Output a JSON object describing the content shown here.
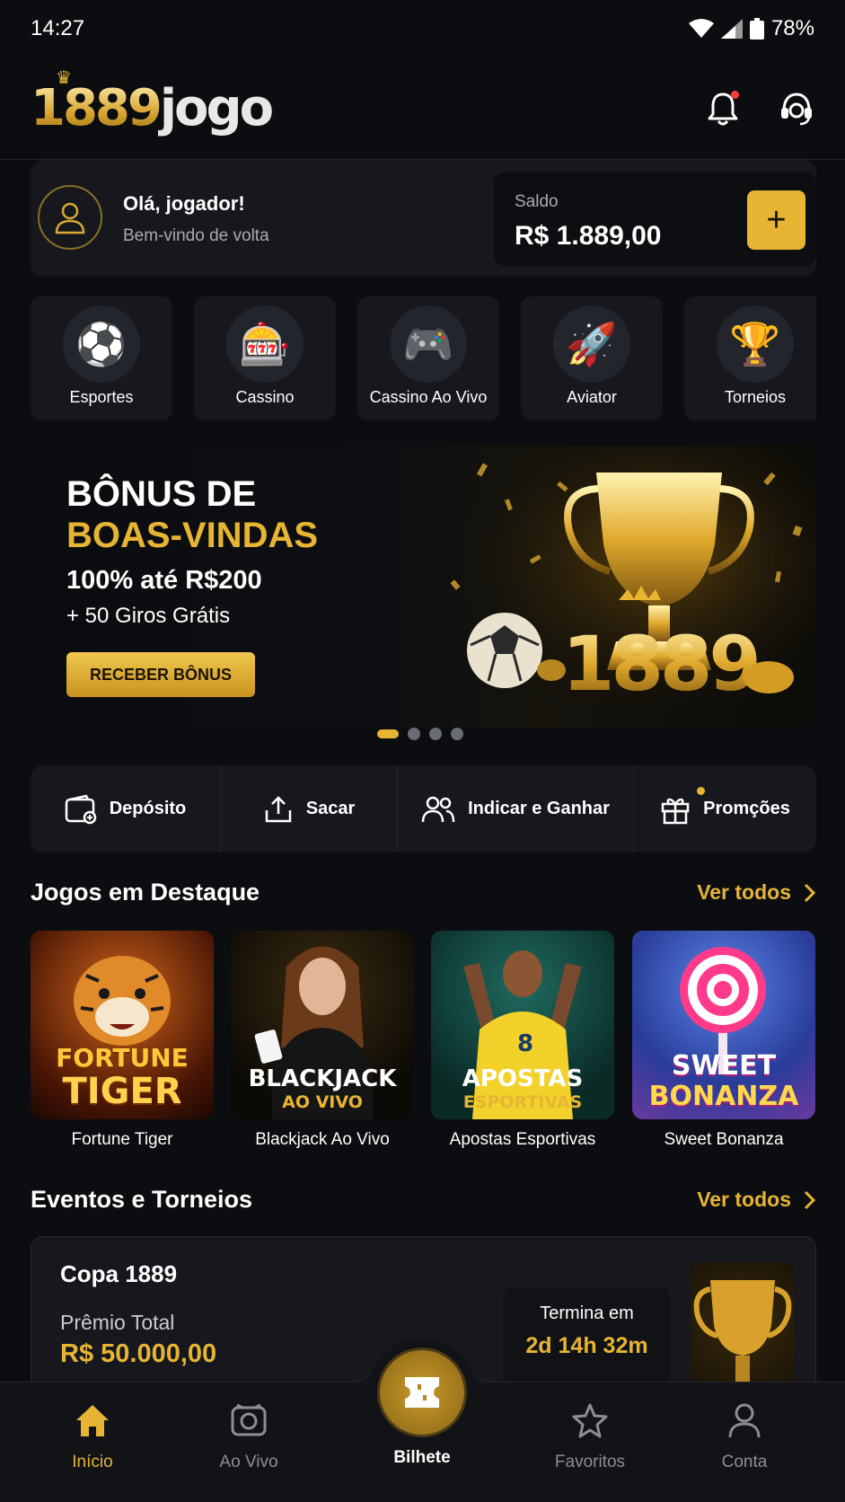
{
  "status": {
    "time": "14:27",
    "battery": "78%"
  },
  "header": {
    "logo_num": "1889",
    "logo_text": "jogo"
  },
  "greeting": {
    "title": "Olá, jogador!",
    "subtitle": "Bem-vindo de volta"
  },
  "balance": {
    "label": "Saldo",
    "value": "R$ 1.889,00",
    "add_label": "+"
  },
  "categories": [
    {
      "label": "Esportes",
      "icon": "soccer-ball-icon",
      "glyph": "⚽"
    },
    {
      "label": "Cassino",
      "icon": "slot-machine-icon",
      "glyph": "🎰"
    },
    {
      "label": "Cassino Ao Vivo",
      "icon": "gamepad-icon",
      "glyph": "🎮"
    },
    {
      "label": "Aviator",
      "icon": "rocket-icon",
      "glyph": "🚀"
    },
    {
      "label": "Torneios",
      "icon": "trophy-icon",
      "glyph": "🏆"
    }
  ],
  "banner": {
    "line1": "BÔNUS DE",
    "line2": "BOAS-VINDAS",
    "line3": "100% até R$200",
    "line4": "+ 50 Giros Grátis",
    "button": "RECEBER BÔNUS",
    "art_text": "1889"
  },
  "quick_actions": [
    {
      "label": "Depósito",
      "icon": "wallet-icon"
    },
    {
      "label": "Sacar",
      "icon": "upload-icon"
    },
    {
      "label": "Indicar e Ganhar",
      "icon": "users-icon"
    },
    {
      "label": "Promções",
      "icon": "gift-icon"
    }
  ],
  "featured": {
    "title": "Jogos em Destaque",
    "see_all": "Ver todos",
    "games": [
      {
        "name": "Fortune Tiger",
        "thumb_l1": "FORTUNE",
        "thumb_l2": "TIGER"
      },
      {
        "name": "Blackjack Ao Vivo",
        "thumb_l1": "BLACKJACK",
        "thumb_l2": "AO VIVO"
      },
      {
        "name": "Apostas Esportivas",
        "thumb_l1": "APOSTAS",
        "thumb_l2": "ESPORTIVAS"
      },
      {
        "name": "Sweet Bonanza",
        "thumb_l1": "SWEET",
        "thumb_l2": "BONANZA"
      }
    ]
  },
  "events": {
    "title": "Eventos e Torneios",
    "see_all": "Ver todos",
    "card": {
      "name": "Copa 1889",
      "prize_label": "Prêmio Total",
      "prize_value": "R$ 50.000,00",
      "ends_label": "Termina em",
      "ends_value": "2d 14h 32m"
    }
  },
  "nav": {
    "items": [
      {
        "label": "Início",
        "icon": "home-icon"
      },
      {
        "label": "Ao Vivo",
        "icon": "live-camera-icon"
      },
      {
        "label": "Bilhete",
        "icon": "ticket-icon"
      },
      {
        "label": "Favoritos",
        "icon": "star-icon"
      },
      {
        "label": "Conta",
        "icon": "user-icon"
      }
    ]
  },
  "colors": {
    "accent": "#e7b533",
    "background": "#0c0d10",
    "card": "#16181d"
  }
}
